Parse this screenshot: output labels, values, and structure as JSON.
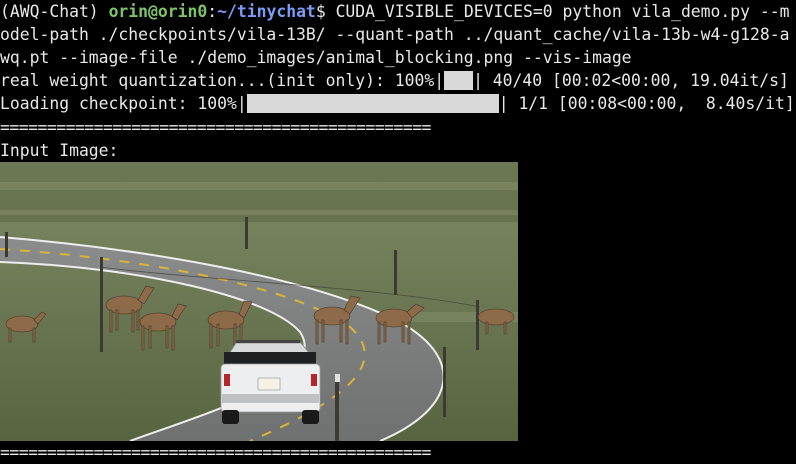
{
  "prompt": {
    "env": "(AWQ-Chat) ",
    "user_host": "orin@orin0",
    "colon": ":",
    "path": "~/tinychat",
    "dollar": "$ ",
    "command_1": "CUDA_VISIBLE_DEVICES=0 python vila_demo.py --m",
    "command_2": "odel-path ./checkpoints/vila-13B/ --quant-path ../quant_cache/vila-13b-w4-g128-a",
    "command_3": "wq.pt --image-file ./demo_images/animal_blocking.png --vis-image"
  },
  "progress": [
    {
      "label": "real weight quantization...(init only): 100%|",
      "fill_fraction": 1.0,
      "stats": "| 40/40 [00:02<00:00, 19.04it/s]"
    },
    {
      "label": "Loading checkpoint: 100%|",
      "fill_fraction": 1.0,
      "stats": "| 1/1 [00:08<00:00,  8.40s/it]"
    }
  ],
  "separator": "==============================================",
  "input_image_label": "Input Image:",
  "image": {
    "description_name": "animal_blocking.png"
  },
  "colors": {
    "background": "#000000",
    "text": "#e8e8e8",
    "prompt_user": "#7ec46a",
    "prompt_path": "#7a9cf5",
    "progress_bar": "#d9d9d9"
  }
}
